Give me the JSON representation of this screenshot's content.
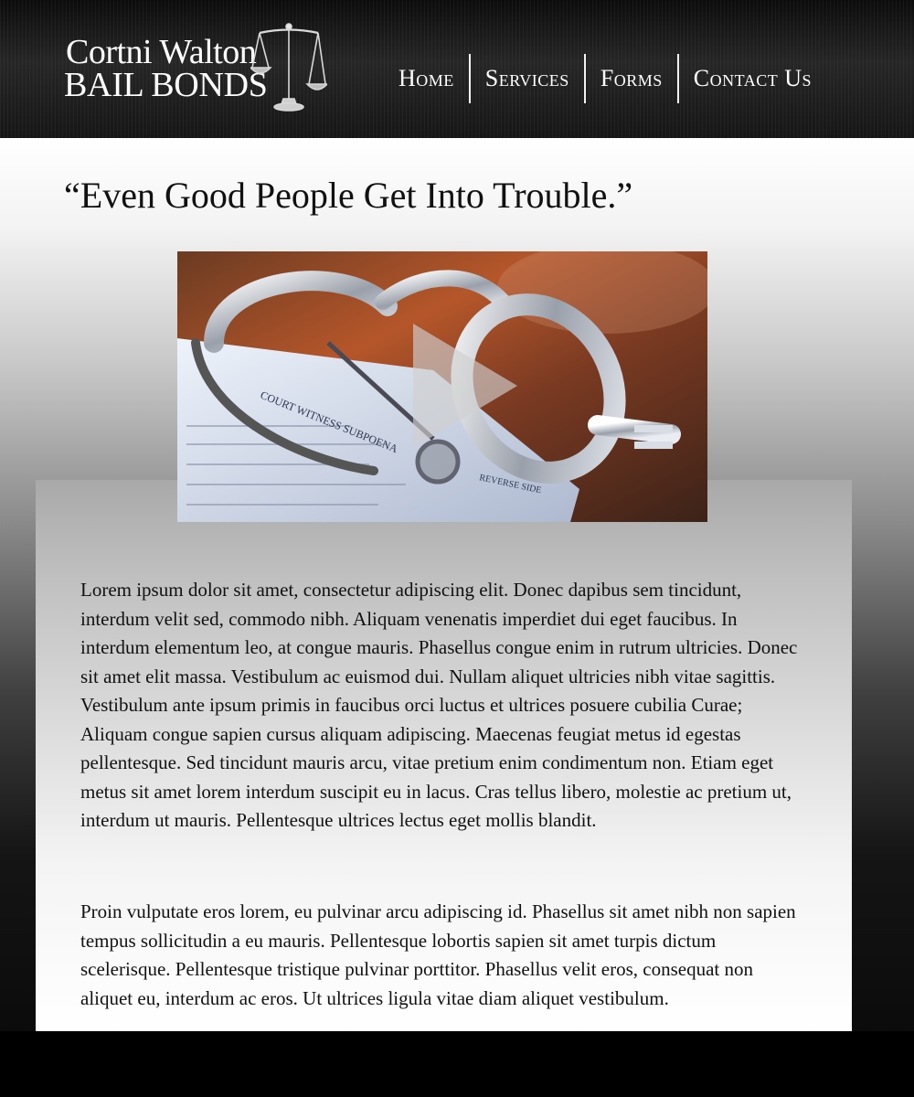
{
  "brand": {
    "name_line1": "Cortni Walton",
    "name_line2": "BAIL BONDS",
    "logo_icon": "scales-of-justice-icon"
  },
  "nav": {
    "items": [
      {
        "label": "Home"
      },
      {
        "label": "Services"
      },
      {
        "label": "Forms"
      },
      {
        "label": "Contact Us"
      }
    ]
  },
  "hero": {
    "tagline": "“Even Good People Get Into Trouble.”",
    "video": {
      "icon": "play-icon",
      "document_text_1": "COURT WITNESS SUBPOENA",
      "document_text_2": "REVERSE SIDE"
    }
  },
  "content": {
    "paragraphs": [
      " Lorem ipsum dolor sit amet, consectetur adipiscing elit. Donec dapibus sem tincidunt, interdum velit sed, commodo nibh. Aliquam venenatis imperdiet dui eget faucibus. In interdum elementum leo, at congue mauris. Phasellus congue enim in rutrum ultricies. Donec sit amet elit massa. Vestibulum ac euismod dui. Nullam aliquet ultricies nibh vitae sagittis. Vestibulum ante ipsum primis in faucibus orci luctus et ultrices posuere cubilia Curae; Aliquam congue sapien cursus aliquam adipiscing. Maecenas feugiat metus id egestas pellentesque. Sed tincidunt mauris arcu, vitae pretium enim condimentum non. Etiam eget metus sit amet lorem interdum suscipit eu in lacus. Cras tellus libero, molestie ac pretium ut, interdum ut mauris. Pellentesque ultrices lectus eget mollis blandit.",
      "Proin vulputate eros lorem, eu pulvinar arcu adipiscing id. Phasellus sit amet nibh non sapien tempus sollicitudin a eu mauris. Pellentesque lobortis sapien sit amet turpis dictum scelerisque. Pellentesque tristique pulvinar porttitor. Phasellus velit eros, consequat non aliquet eu, interdum ac eros. Ut ultrices ligula vitae diam aliquet vestibulum."
    ]
  },
  "colors": {
    "header_bg": "#1a1a1a",
    "nav_text": "#ffffff",
    "body_text": "#111111",
    "footer_band": "#000000"
  }
}
